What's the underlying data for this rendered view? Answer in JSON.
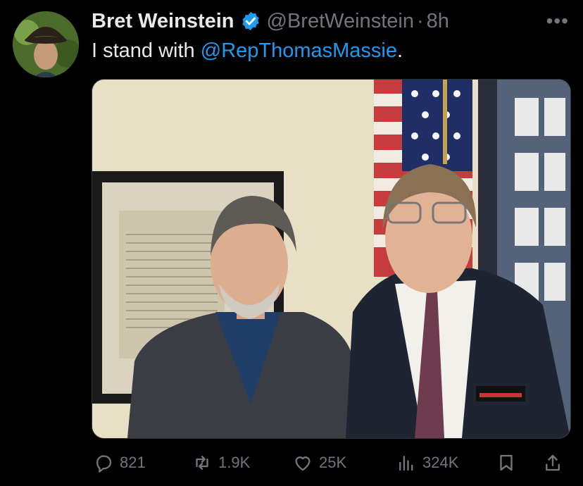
{
  "author": {
    "name": "Bret Weinstein",
    "handle": "@BretWeinstein",
    "time": "8h"
  },
  "tweet": {
    "text_prefix": "I stand with ",
    "mention": "@RepThomasMassie",
    "text_suffix": "."
  },
  "actions": {
    "replies": "821",
    "reposts": "1.9K",
    "likes": "25K",
    "views": "324K"
  },
  "colors": {
    "background": "#000000",
    "text": "#e7e9ea",
    "muted": "#71767b",
    "accent": "#1d9bf0"
  },
  "icons": [
    "more-icon",
    "verified-icon",
    "reply-icon",
    "repost-icon",
    "like-icon",
    "views-icon",
    "bookmark-icon",
    "share-icon"
  ]
}
